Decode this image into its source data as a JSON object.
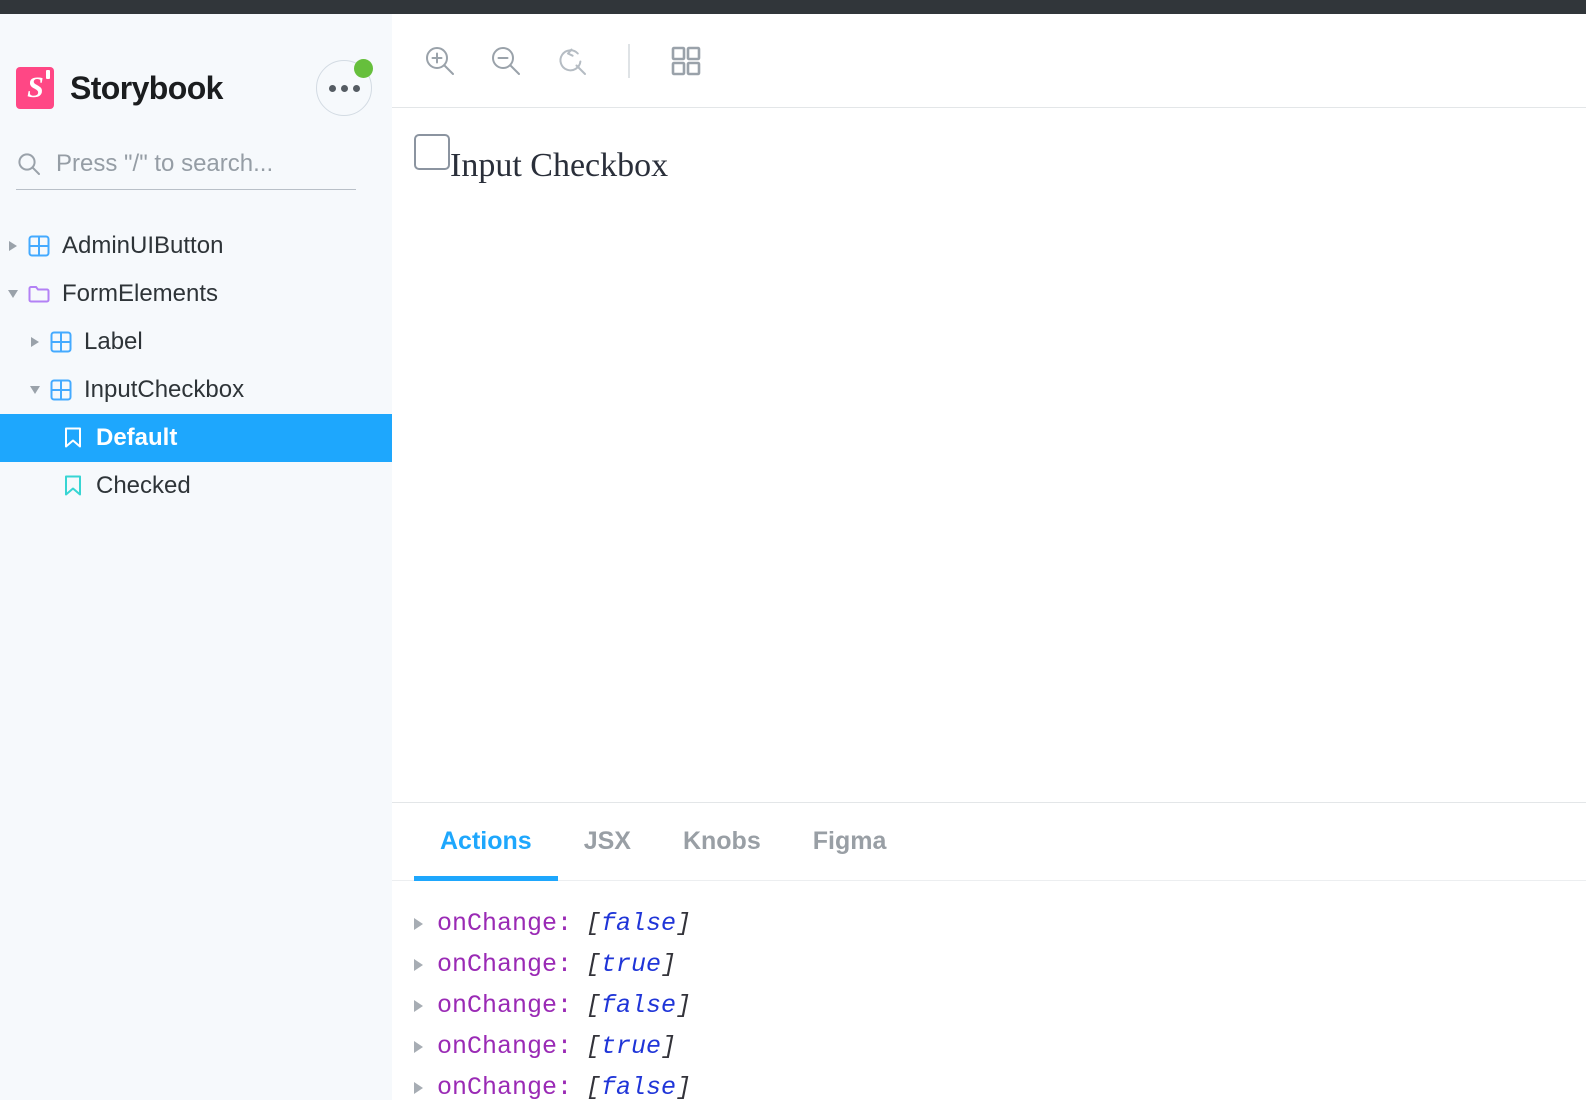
{
  "brand": {
    "name": "Storybook",
    "logo_icon": "storybook-logo-icon",
    "more_icon": "ellipsis-icon",
    "badge_color": "#66bf3c",
    "accent_color": "#ff4785"
  },
  "search": {
    "placeholder": "Press \"/\" to search...",
    "value": "",
    "icon": "search-icon"
  },
  "sidebar": {
    "background_color": "#f6f9fc",
    "selected_color": "#1ea7fd",
    "items": [
      {
        "label": "AdminUIButton",
        "depth": 0,
        "icon": "component-icon",
        "arrow": "right",
        "selected": false
      },
      {
        "label": "FormElements",
        "depth": 0,
        "icon": "folder-icon",
        "arrow": "down",
        "selected": false
      },
      {
        "label": "Label",
        "depth": 1,
        "icon": "component-icon",
        "arrow": "right",
        "selected": false
      },
      {
        "label": "InputCheckbox",
        "depth": 1,
        "icon": "component-icon",
        "arrow": "down",
        "selected": false
      },
      {
        "label": "Default",
        "depth": 2,
        "icon": "story-bookmark-icon",
        "arrow": "none",
        "selected": true
      },
      {
        "label": "Checked",
        "depth": 2,
        "icon": "story-bookmark-icon",
        "arrow": "none",
        "selected": false
      }
    ]
  },
  "toolbar": {
    "buttons": [
      {
        "name": "zoom-in-icon",
        "title": "Zoom in"
      },
      {
        "name": "zoom-out-icon",
        "title": "Zoom out"
      },
      {
        "name": "zoom-reset-icon",
        "title": "Reset zoom"
      },
      {
        "name": "grid-icon",
        "title": "Change background"
      }
    ]
  },
  "preview": {
    "checkbox_label": "Input Checkbox",
    "checkbox_checked": false
  },
  "addons": {
    "tabs": [
      {
        "label": "Actions",
        "active": true
      },
      {
        "label": "JSX",
        "active": false
      },
      {
        "label": "Knobs",
        "active": false
      },
      {
        "label": "Figma",
        "active": false
      }
    ],
    "actions": [
      {
        "key": "onChange:",
        "value": "false"
      },
      {
        "key": "onChange:",
        "value": "true"
      },
      {
        "key": "onChange:",
        "value": "false"
      },
      {
        "key": "onChange:",
        "value": "true"
      },
      {
        "key": "onChange:",
        "value": "false"
      }
    ]
  }
}
